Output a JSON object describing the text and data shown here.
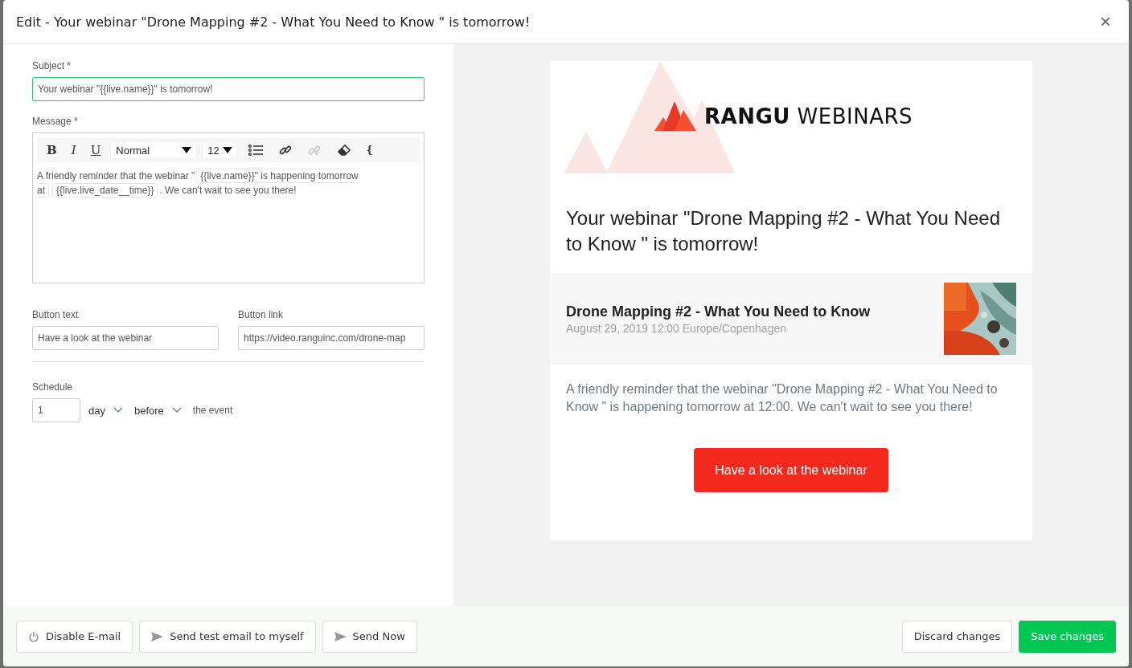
{
  "window": {
    "title": "Edit - Your webinar \"Drone Mapping #2 - What You Need to Know \" is tomorrow!",
    "close": "×"
  },
  "form": {
    "subject": {
      "label": "Subject *",
      "value": "Your webinar \"{{live.name}}\" is tomorrow!",
      "focused": true
    },
    "message": {
      "label": "Message *",
      "toolbar": [
        {
          "kind": "bold",
          "label": "B"
        },
        {
          "kind": "italic",
          "label": "I"
        },
        {
          "kind": "underline",
          "label": "U"
        },
        {
          "kind": "select",
          "label": "Normal"
        },
        {
          "kind": "small-select",
          "label": "12"
        },
        {
          "kind": "list",
          "disabled": false
        },
        {
          "kind": "link",
          "disabled": false
        },
        {
          "kind": "unlink",
          "disabled": true
        },
        {
          "kind": "eraser",
          "disabled": false
        },
        {
          "kind": "glyph",
          "label": "{"
        }
      ],
      "segments": [
        {
          "kind": "text",
          "text": "A friendly reminder that the webinar \""
        },
        {
          "kind": "tag",
          "text": "{{live.name}}\" is happening tomorrow at"
        },
        {
          "kind": "tag",
          "text": "{{live.live_date__time}}"
        },
        {
          "kind": "text",
          "text": ". We can't wait to see you there!"
        }
      ]
    },
    "button_text": {
      "label": "Button text",
      "value": "Have a look at the webinar"
    },
    "button_link": {
      "label": "Button link",
      "value": "https://video.ranguinc.com/drone-map"
    },
    "schedule": {
      "label": "Schedule",
      "amount": "1",
      "unit": "day",
      "relation": "before",
      "suffix": "the event"
    }
  },
  "preview": {
    "logo": {
      "brand": "RANGU",
      "suffix": "WEBINARS"
    },
    "heading": "Your webinar \"Drone Mapping #2 - What You Need to Know \" is tomorrow!",
    "event": {
      "title": "Drone Mapping #2 - What You Need to Know",
      "date": "August 29, 2019 12:00 Europe/Copenhagen"
    },
    "body": "A friendly reminder that the webinar \"Drone Mapping #2 - What You Need to Know \" is happening tomorrow at 12:00. We can't wait to see you there!",
    "cta": "Have a look at the webinar"
  },
  "footer": {
    "left": [
      {
        "label": "Disable E-mail",
        "kind": "power"
      },
      {
        "label": "Send test email to myself",
        "kind": "send"
      },
      {
        "label": "Send Now",
        "kind": "send"
      }
    ],
    "right": [
      {
        "label": "Discard changes",
        "primary": false
      },
      {
        "label": "Save changes",
        "primary": true
      }
    ]
  }
}
